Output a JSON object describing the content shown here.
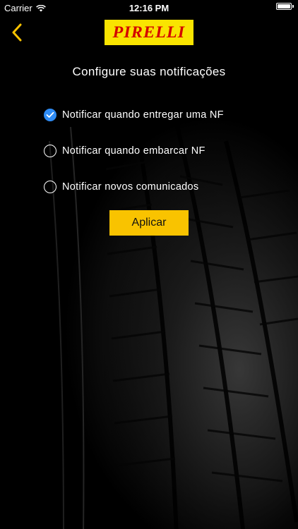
{
  "status_bar": {
    "carrier": "Carrier",
    "time": "12:16 PM",
    "icons": [
      "wifi-icon",
      "battery-icon"
    ]
  },
  "nav": {
    "back_icon": "chevron-left-icon",
    "logo_text": "PIRELLI",
    "accent_color": "#f9c300"
  },
  "page": {
    "title": "Configure suas notificações"
  },
  "options": [
    {
      "label": "Notificar quando entregar uma NF",
      "checked": true
    },
    {
      "label": "Notificar quando embarcar NF",
      "checked": false
    },
    {
      "label": "Notificar novos comunicados",
      "checked": false
    }
  ],
  "apply_button": {
    "label": "Aplicar"
  }
}
